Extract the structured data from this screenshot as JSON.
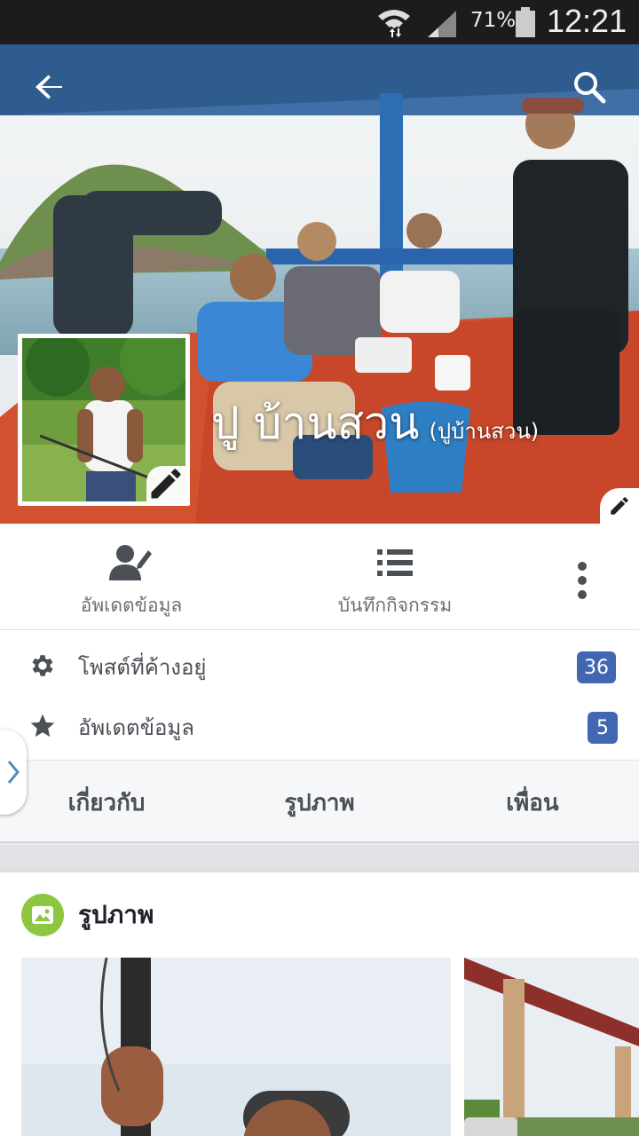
{
  "status_bar": {
    "battery_percent": "71%",
    "time": "12:21"
  },
  "profile": {
    "name": "ปู บ้านสวน",
    "alt_name": "(ปูบ้านสวน)"
  },
  "actions": [
    {
      "label": "อัพเดตข้อมูล",
      "icon": "person-edit-icon"
    },
    {
      "label": "บันทึกกิจกรรม",
      "icon": "list-icon"
    },
    {
      "label": "",
      "icon": "more-vertical-icon"
    }
  ],
  "list": [
    {
      "label": "โพสต์ที่ค้างอยู่",
      "count": "36",
      "icon": "gear-icon"
    },
    {
      "label": "อัพเดตข้อมูล",
      "count": "5",
      "icon": "star-icon"
    }
  ],
  "tabs": [
    "เกี่ยวกับ",
    "รูปภาพ",
    "เพื่อน"
  ],
  "photos": {
    "title": "รูปภาพ",
    "icon": "photo-icon"
  },
  "colors": {
    "badge": "#4267b2",
    "photos_icon": "#8dc63f",
    "status_bar": "#1c1c1c"
  }
}
